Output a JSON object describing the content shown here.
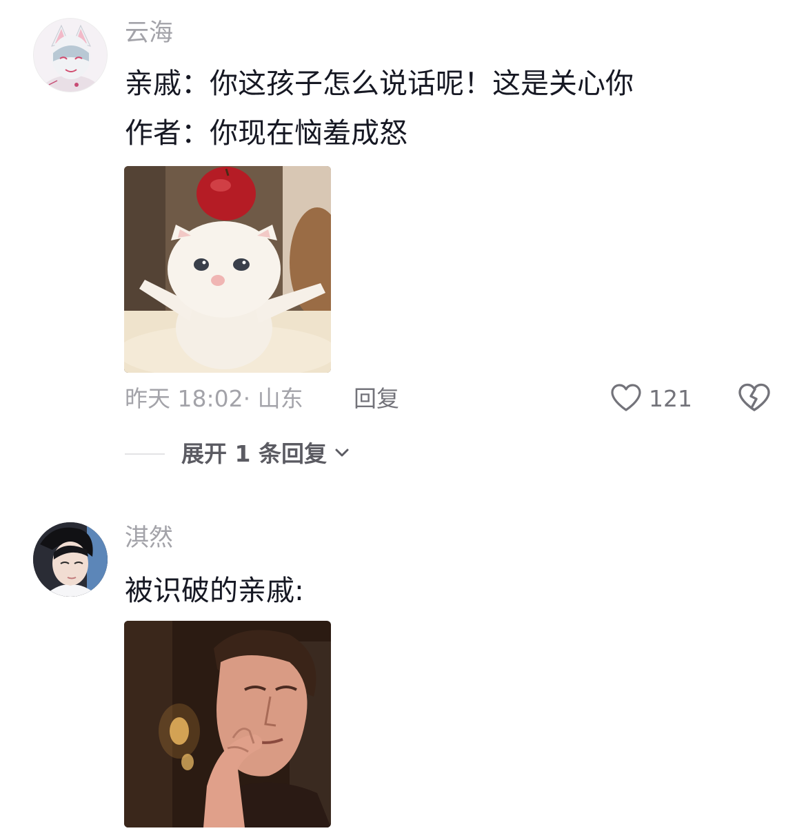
{
  "comments": [
    {
      "username": "云海",
      "content_lines": [
        "亲戚：你这孩子怎么说话呢！这是关心你",
        "作者：你现在恼羞成怒"
      ],
      "sticker": "kitten-with-apple-sticker",
      "timestamp": "昨天 18:02· 山东",
      "reply_label": "回复",
      "like_count": "121",
      "expand_replies_label": "展开 1 条回复"
    },
    {
      "username": "淇然",
      "content_lines": [
        "被识破的亲戚:"
      ],
      "sticker": "man-thinking-sticker"
    }
  ],
  "icons": {
    "like": "heart-outline-icon",
    "dislike": "broken-heart-icon",
    "expand": "chevron-down-icon"
  },
  "colors": {
    "text_primary": "#161823",
    "text_secondary": "#a3a3a9",
    "action_text": "#73737a"
  }
}
